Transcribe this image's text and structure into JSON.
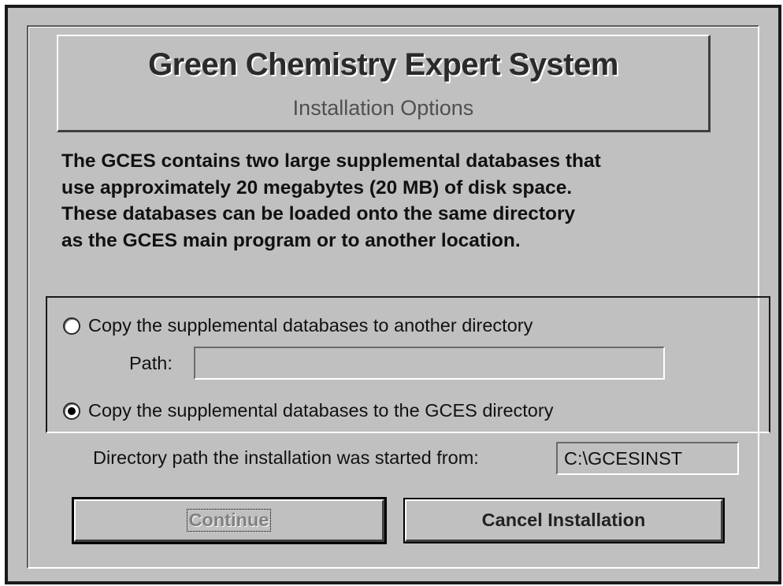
{
  "header": {
    "title": "Green Chemistry Expert System",
    "subtitle": "Installation Options"
  },
  "description": "The GCES contains two large supplemental databases that\nuse approximately 20 megabytes (20 MB) of disk space.\nThese databases can be loaded onto the same directory\nas the GCES main program or to another location.",
  "options": {
    "other_directory_label": "Copy the supplemental databases to another directory",
    "other_directory_selected": false,
    "path_label": "Path:",
    "path_value": "",
    "gces_directory_label": "Copy the supplemental  databases to the GCES directory",
    "gces_directory_selected": true
  },
  "install_source": {
    "label": "Directory path the installation was started from:",
    "value": "C:\\GCESINST"
  },
  "buttons": {
    "continue_label": "Continue",
    "cancel_label": "Cancel Installation"
  }
}
